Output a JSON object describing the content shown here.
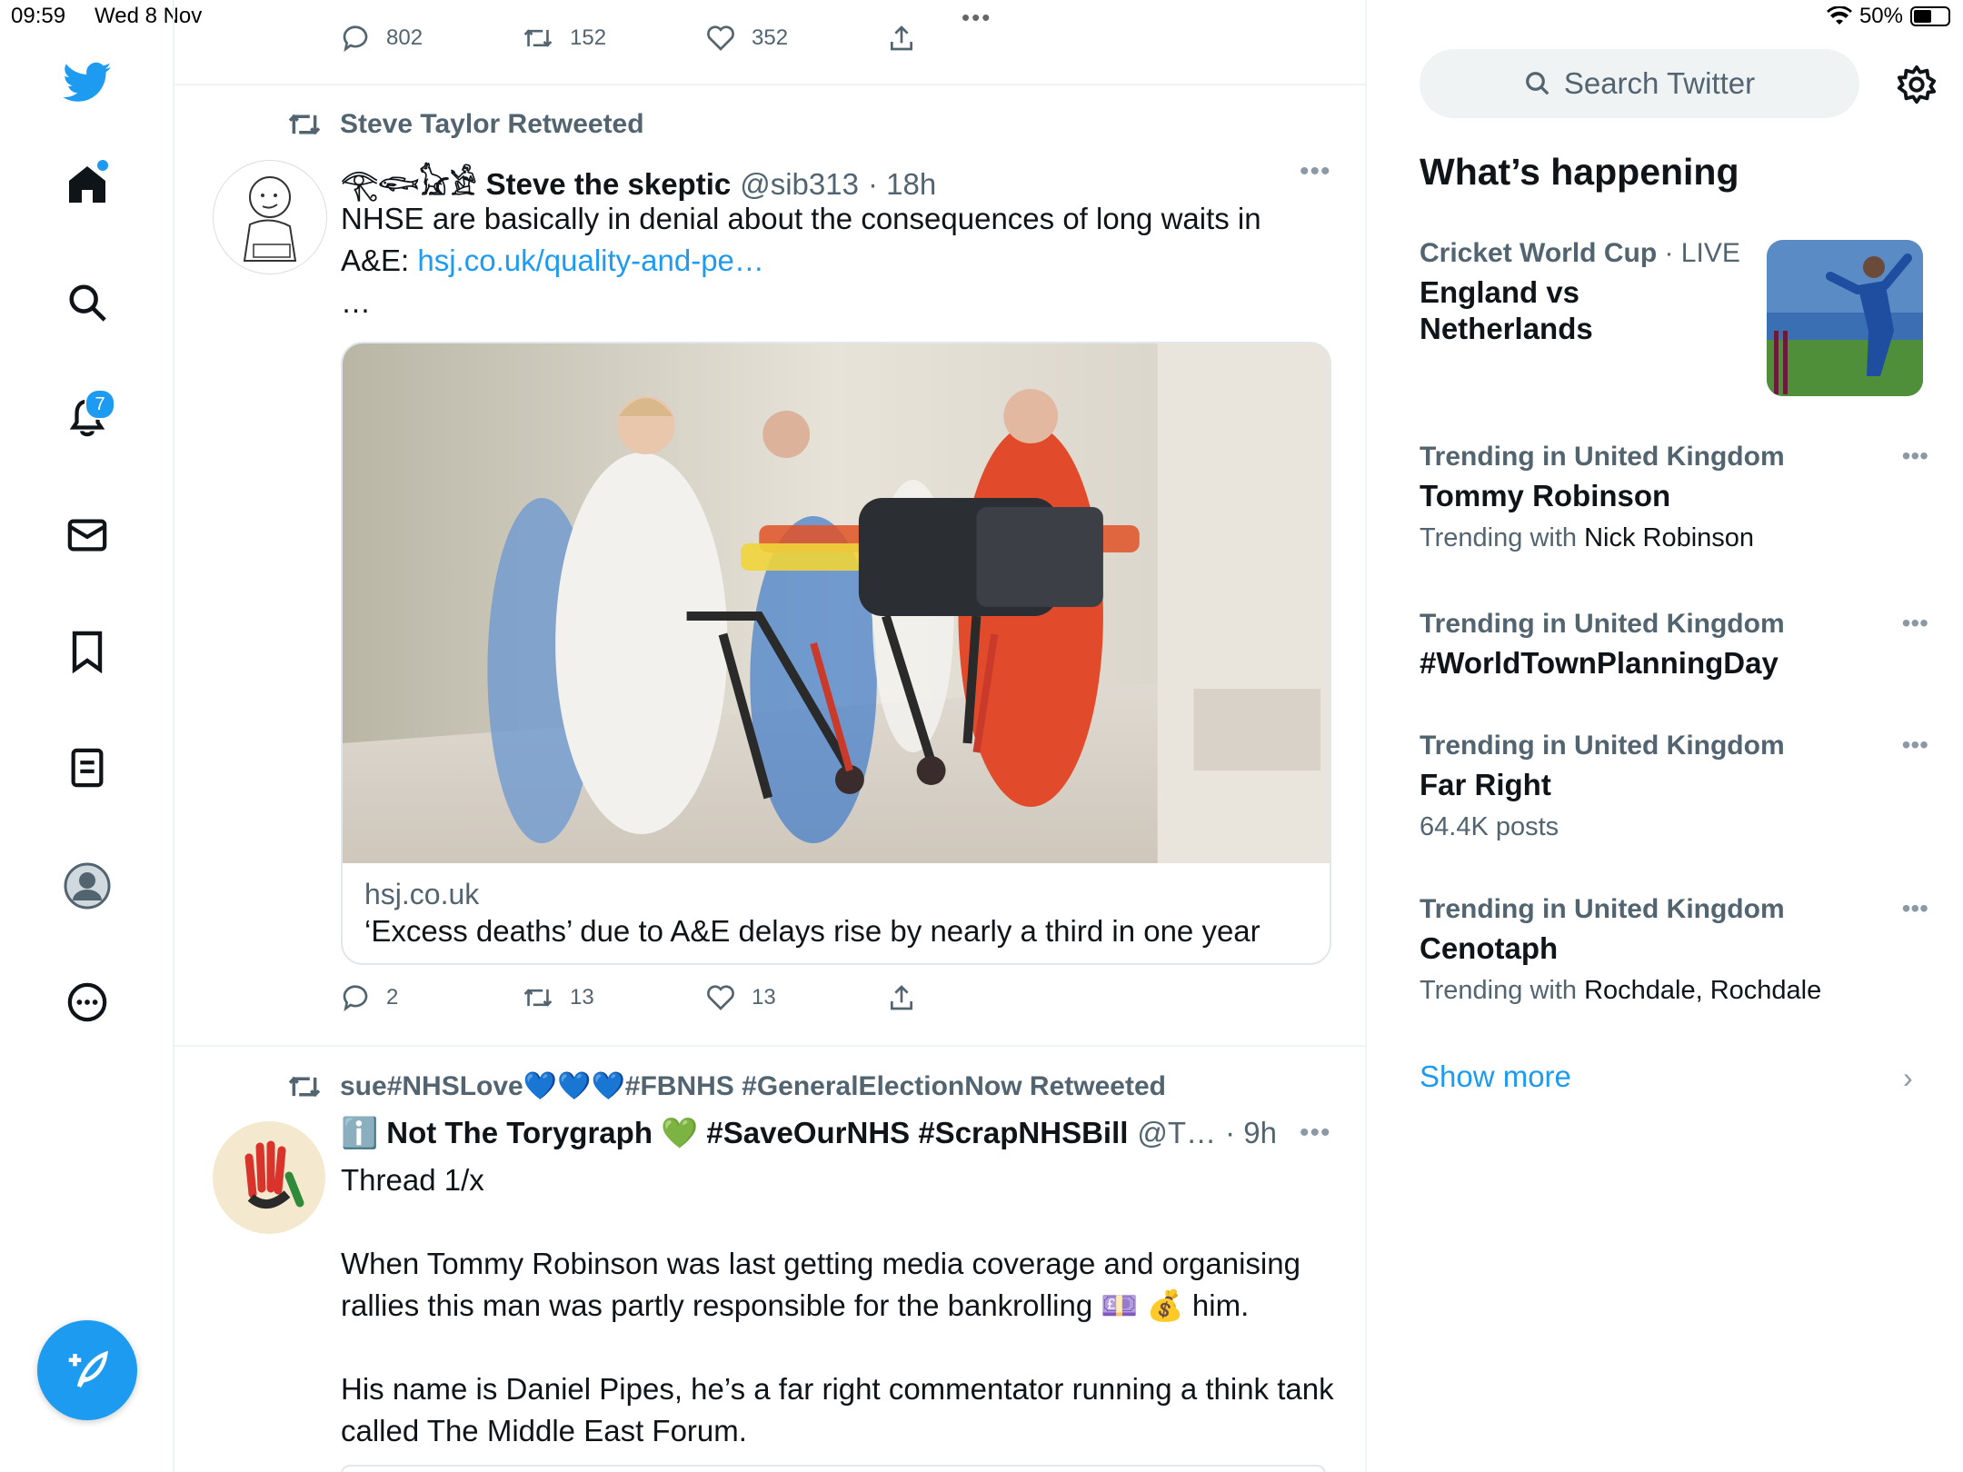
{
  "status_bar": {
    "time": "09:59",
    "date": "Wed 8 Nov",
    "battery": "50%"
  },
  "nav": {
    "notifications_count": "7"
  },
  "top_tweet_actions": {
    "replies": "802",
    "retweets": "152",
    "likes": "352"
  },
  "tweet1": {
    "retweeted_by": "Steve Taylor Retweeted",
    "name_prefix": "𓂀𓆟𓃠𓀀",
    "name": "Steve the skeptic",
    "handle": "@sib313",
    "time": "· 18h",
    "text_before_link": "NHSE are basically in denial about the consequences of long waits in A&E: ",
    "link": "hsj.co.uk/quality-and-pe…",
    "ellipsis": "…",
    "card_domain": "hsj.co.uk",
    "card_title": "‘Excess deaths’ due to A&E delays rise by nearly a third in one year",
    "replies": "2",
    "retweets": "13",
    "likes": "13"
  },
  "tweet2": {
    "retweeted_by": "sue#NHSLove💙💙💙#FBNHS #GeneralElectionNow Retweeted",
    "name": "ℹ️ Not The Torygraph 💚 #SaveOurNHS #ScrapNHSBill",
    "handle": "@T…",
    "time": "· 9h",
    "para1": "Thread 1/x",
    "para2": "When Tommy Robinson was last getting media coverage and organising rallies this man was partly responsible for the bankrolling 💷 💰 him.",
    "para3": "His name is Daniel Pipes, he’s a far right commentator running a think tank called The Middle East Forum."
  },
  "sidebar": {
    "search_placeholder": "Search Twitter",
    "section_title": "What’s happening",
    "trends": [
      {
        "meta": "Cricket World Cup",
        "live": " · LIVE",
        "title": "England vs Netherlands",
        "sub_prefix": "",
        "sub_value": ""
      },
      {
        "meta": "Trending in United Kingdom",
        "title": "Tommy Robinson",
        "sub_prefix": "Trending with ",
        "sub_value": "Nick Robinson"
      },
      {
        "meta": "Trending in United Kingdom",
        "title": "#WorldTownPlanningDay",
        "sub_prefix": "",
        "sub_value": ""
      },
      {
        "meta": "Trending in United Kingdom",
        "title": "Far Right",
        "sub_prefix": "64.4K posts",
        "sub_value": ""
      },
      {
        "meta": "Trending in United Kingdom",
        "title": "Cenotaph",
        "sub_prefix": "Trending with ",
        "sub_value": "Rochdale, Rochdale"
      }
    ],
    "show_more": "Show more"
  },
  "colors": {
    "accent": "#1d9bf0",
    "text": "#0f1419",
    "muted": "#536471",
    "border": "#eff3f4"
  }
}
